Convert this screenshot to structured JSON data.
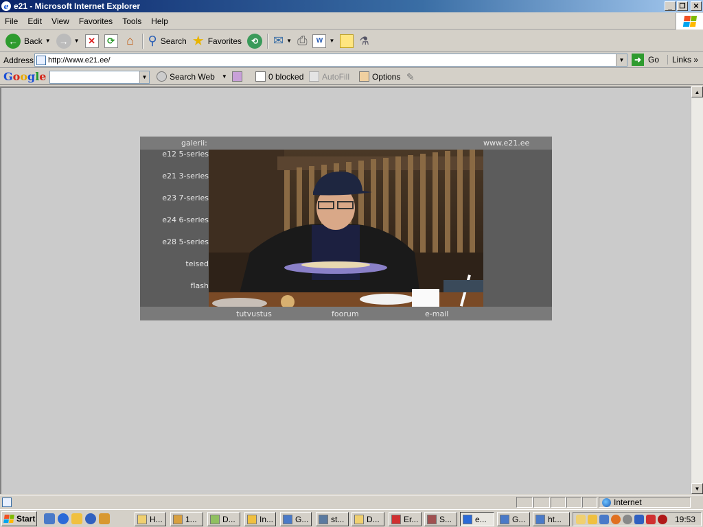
{
  "window": {
    "title": "e21 - Microsoft Internet Explorer"
  },
  "menu": [
    "File",
    "Edit",
    "View",
    "Favorites",
    "Tools",
    "Help"
  ],
  "toolbar": {
    "back": "Back",
    "search": "Search",
    "favorites": "Favorites"
  },
  "address": {
    "label": "Address",
    "url": "http://www.e21.ee/",
    "go": "Go",
    "links": "Links"
  },
  "google": {
    "search_web": "Search Web",
    "blocked": "0 blocked",
    "autofill": "AutoFill",
    "options": "Options"
  },
  "site": {
    "galerii": "galerii:",
    "domain": "www.e21.ee",
    "menu": [
      "e12 5-series",
      "e21 3-series",
      "e23 7-series",
      "e24 6-series",
      "e28 5-series",
      "teised",
      "flash"
    ],
    "footer": [
      "tutvustus",
      "foorum",
      "e-mail"
    ]
  },
  "status": {
    "zone": "Internet"
  },
  "taskbar": {
    "start": "Start",
    "tasks": [
      "H...",
      "1...",
      "D...",
      "In...",
      "G...",
      "st...",
      "D...",
      "Er...",
      "S...",
      "e...",
      "G...",
      "ht..."
    ],
    "clock": "19:53"
  }
}
